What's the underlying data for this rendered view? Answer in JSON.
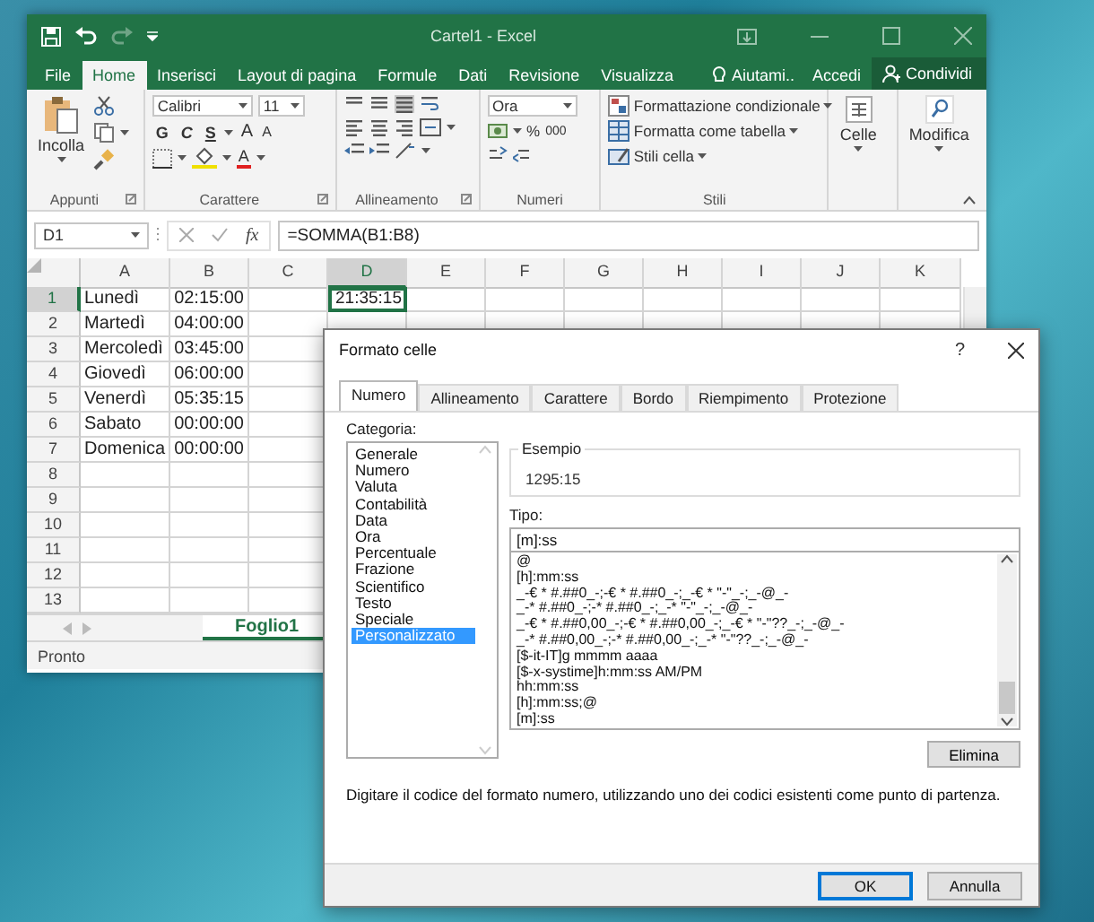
{
  "excel": {
    "title": "Cartel1 - Excel",
    "tabs": [
      {
        "label": "File",
        "selected": false
      },
      {
        "label": "Home",
        "selected": true
      },
      {
        "label": "Inserisci",
        "selected": false
      },
      {
        "label": "Layout di pagina",
        "selected": false
      },
      {
        "label": "Formule",
        "selected": false
      },
      {
        "label": "Dati",
        "selected": false
      },
      {
        "label": "Revisione",
        "selected": false
      },
      {
        "label": "Visualizza",
        "selected": false
      }
    ],
    "tell_me": "Aiutami..",
    "sign_in": "Accedi",
    "share": "Condividi",
    "ribbon": {
      "clipboard": {
        "paste": "Incolla",
        "label": "Appunti"
      },
      "font": {
        "name": "Calibri",
        "size": "11",
        "bold": "G",
        "italic": "C",
        "underline": "S",
        "grow": "A",
        "shrink": "A",
        "font_color": "A",
        "label": "Carattere"
      },
      "alignment": {
        "label": "Allineamento"
      },
      "number": {
        "format": "Ora",
        "percent": "%",
        "thousands": "000",
        "label": "Numeri"
      },
      "styles": {
        "items": [
          "Formattazione condizionale",
          "Formatta come tabella",
          "Stili cella"
        ],
        "label": "Stili"
      },
      "cells": {
        "button": "Celle"
      },
      "editing": {
        "button": "Modifica"
      }
    },
    "name_box": "D1",
    "fx": "fx",
    "formula": "=SOMMA(B1:B8)",
    "sheet": {
      "columns": [
        {
          "label": "A",
          "selected": false
        },
        {
          "label": "B",
          "selected": false
        },
        {
          "label": "C",
          "selected": false
        },
        {
          "label": "D",
          "selected": true
        },
        {
          "label": "E",
          "selected": false
        },
        {
          "label": "F",
          "selected": false
        },
        {
          "label": "G",
          "selected": false
        },
        {
          "label": "H",
          "selected": false
        },
        {
          "label": "I",
          "selected": false
        },
        {
          "label": "J",
          "selected": false
        },
        {
          "label": "K",
          "selected": false
        }
      ],
      "rows": [
        {
          "header": "1",
          "selected": true,
          "cells": [
            "Lunedì",
            "02:15:00",
            null,
            "21:35:15"
          ]
        },
        {
          "header": "2",
          "selected": false,
          "cells": [
            "Martedì",
            "04:00:00"
          ]
        },
        {
          "header": "3",
          "selected": false,
          "cells": [
            "Mercoledì",
            "03:45:00"
          ]
        },
        {
          "header": "4",
          "selected": false,
          "cells": [
            "Giovedì",
            "06:00:00"
          ]
        },
        {
          "header": "5",
          "selected": false,
          "cells": [
            "Venerdì",
            "05:35:15"
          ]
        },
        {
          "header": "6",
          "selected": false,
          "cells": [
            "Sabato",
            "00:00:00"
          ]
        },
        {
          "header": "7",
          "selected": false,
          "cells": [
            "Domenica",
            "00:00:00"
          ]
        },
        {
          "header": "8",
          "selected": false,
          "cells": []
        },
        {
          "header": "9",
          "selected": false,
          "cells": []
        },
        {
          "header": "10",
          "selected": false,
          "cells": []
        },
        {
          "header": "11",
          "selected": false,
          "cells": []
        },
        {
          "header": "12",
          "selected": false,
          "cells": []
        },
        {
          "header": "13",
          "selected": false,
          "cells": []
        }
      ]
    },
    "sheet_tabs": [
      {
        "label": "Foglio1",
        "selected": true
      }
    ],
    "status": "Pronto"
  },
  "dialog": {
    "title": "Formato celle",
    "help": "?",
    "tabs": [
      {
        "label": "Numero",
        "selected": true
      },
      {
        "label": "Allineamento",
        "selected": false
      },
      {
        "label": "Carattere",
        "selected": false
      },
      {
        "label": "Bordo",
        "selected": false
      },
      {
        "label": "Riempimento",
        "selected": false
      },
      {
        "label": "Protezione",
        "selected": false
      }
    ],
    "category_label": "Categoria:",
    "categories": [
      {
        "label": "Generale",
        "selected": false
      },
      {
        "label": "Numero",
        "selected": false
      },
      {
        "label": "Valuta",
        "selected": false
      },
      {
        "label": "Contabilità",
        "selected": false
      },
      {
        "label": "Data",
        "selected": false
      },
      {
        "label": "Ora",
        "selected": false
      },
      {
        "label": "Percentuale",
        "selected": false
      },
      {
        "label": "Frazione",
        "selected": false
      },
      {
        "label": "Scientifico",
        "selected": false
      },
      {
        "label": "Testo",
        "selected": false
      },
      {
        "label": "Speciale",
        "selected": false
      },
      {
        "label": "Personalizzato",
        "selected": true
      }
    ],
    "sample_label": "Esempio",
    "sample": "1295:15",
    "type_label": "Tipo:",
    "type_value": "[m]:ss",
    "formats": [
      "@",
      "[h]:mm:ss",
      "_-€ * #.##0_-;-€ * #.##0_-;_-€ * \"-\"_-;_-@_-",
      "_-* #.##0_-;-* #.##0_-;_-* \"-\"_-;_-@_-",
      "_-€ * #.##0,00_-;-€ * #.##0,00_-;_-€ * \"-\"??_-;_-@_-",
      "_-* #.##0,00_-;-* #.##0,00_-;_-* \"-\"??_-;_-@_-",
      "[$-it-IT]g mmmm aaaa",
      "[$-x-systime]h:mm:ss AM/PM",
      "hh:mm:ss",
      "[h]:mm:ss;@",
      "[m]:ss"
    ],
    "delete_button": "Elimina",
    "description": "Digitare il codice del formato numero, utilizzando uno dei codici esistenti come punto di partenza.",
    "ok": "OK",
    "cancel": "Annulla"
  }
}
